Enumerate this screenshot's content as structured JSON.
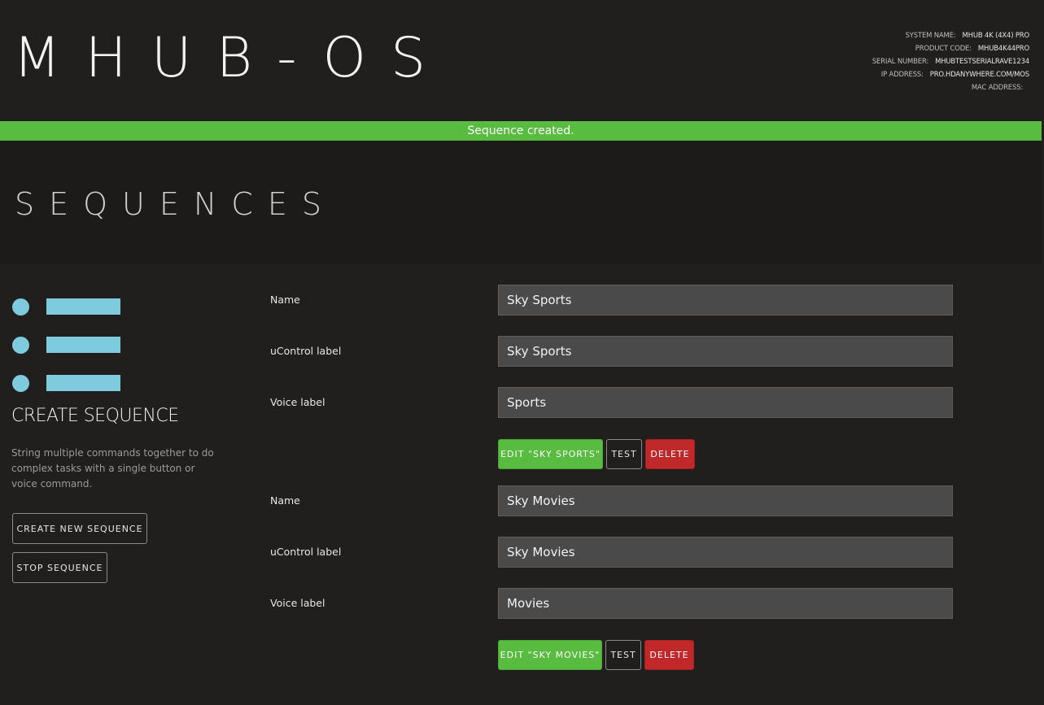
{
  "header": {
    "brand": "MHUB-OS",
    "system_info": [
      {
        "key": "SYSTEM NAME:",
        "value": "MHUB 4K (4X4) PRO"
      },
      {
        "key": "PRODUCT CODE:",
        "value": "MHUB4K44PRO"
      },
      {
        "key": "SERIAL NUMBER:",
        "value": "MHUBTESTSERIALRAVE1234"
      },
      {
        "key": "IP ADDRESS:",
        "value": "PRO.HDANYWHERE.COM/MOS"
      },
      {
        "key": "MAC ADDRESS:",
        "value": ""
      }
    ]
  },
  "banner": {
    "message": "Sequence created.",
    "color": "#57bc3f"
  },
  "page": {
    "title": "SEQUENCES"
  },
  "sidebar": {
    "title": "CREATE SEQUENCE",
    "description": "String multiple commands together to do complex tasks with a single button or voice command.",
    "create_button": "CREATE NEW SEQUENCE",
    "stop_button": "STOP SEQUENCE",
    "accent_color": "#7ecbdd"
  },
  "labels": {
    "name": "Name",
    "ucontrol": "uControl label",
    "voice": "Voice label"
  },
  "sequences": [
    {
      "name": "Sky Sports",
      "ucontrol_label": "Sky Sports",
      "voice_label": "Sports",
      "edit_button": "EDIT \"SKY SPORTS\"",
      "test_button": "TEST",
      "delete_button": "DELETE"
    },
    {
      "name": "Sky Movies",
      "ucontrol_label": "Sky Movies",
      "voice_label": "Movies",
      "edit_button": "EDIT \"SKY MOVIES\"",
      "test_button": "TEST",
      "delete_button": "DELETE"
    }
  ],
  "colors": {
    "edit": "#57bc3f",
    "delete": "#c0282a",
    "background": "#211f1d"
  }
}
